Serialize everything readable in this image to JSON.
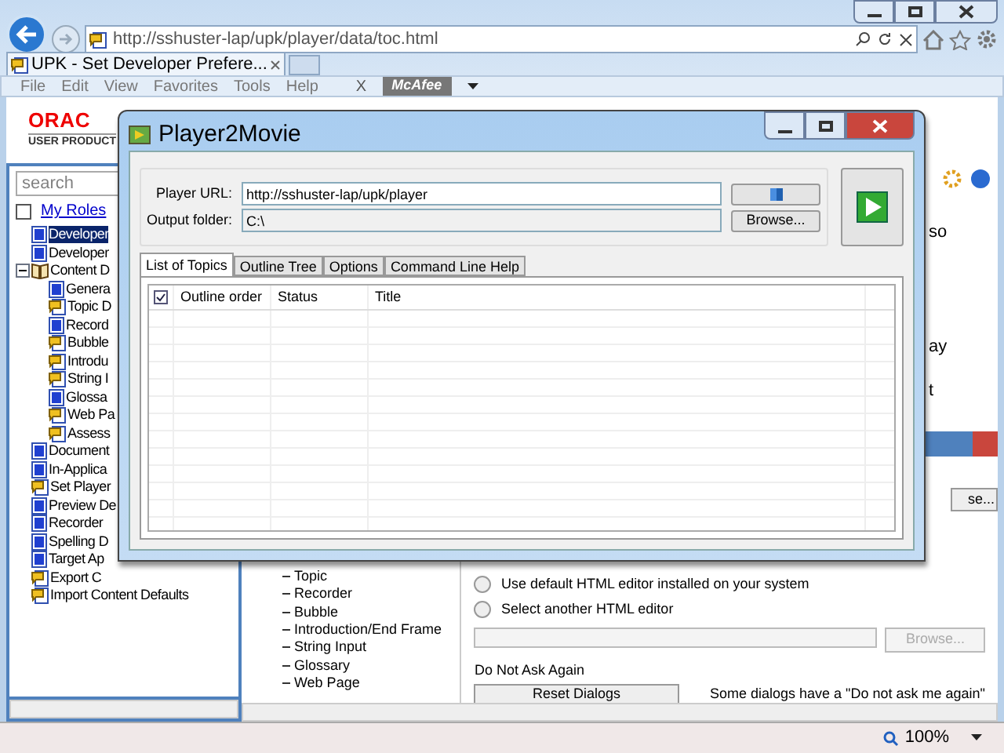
{
  "browser": {
    "address": "http://sshuster-lap/upk/player/data/toc.html",
    "tab": "UPK - Set Developer Prefere...",
    "menu": [
      "File",
      "Edit",
      "View",
      "Favorites",
      "Tools",
      "Help"
    ],
    "toolbar_close": "X",
    "addon": "McAfee",
    "zoom": "100%"
  },
  "logo": {
    "name": "ORAC",
    "subtitle": "USER PRODUCT"
  },
  "left_pane": {
    "search": {
      "placeholder": "search"
    },
    "roles": {
      "label": "My Roles",
      "checked": false
    },
    "tree": [
      {
        "label": "Developer",
        "kind": "page",
        "selected": true
      },
      {
        "label": "Developer",
        "kind": "page",
        "selected": false
      },
      {
        "label": "Content D",
        "kind": "book",
        "selected": false,
        "expanded": true,
        "children": [
          {
            "label": "Genera",
            "kind": "page",
            "selected": false
          },
          {
            "label": "Topic D",
            "kind": "bubble",
            "selected": false
          },
          {
            "label": "Record",
            "kind": "page",
            "selected": false
          },
          {
            "label": "Bubble",
            "kind": "bubble",
            "selected": false
          },
          {
            "label": "Introdu",
            "kind": "bubble",
            "selected": false
          },
          {
            "label": "String I",
            "kind": "bubble",
            "selected": false
          },
          {
            "label": "Glossa",
            "kind": "page",
            "selected": false
          },
          {
            "label": "Web Pa",
            "kind": "bubble",
            "selected": false
          },
          {
            "label": "Assess",
            "kind": "bubble",
            "selected": false
          }
        ]
      },
      {
        "label": "Document",
        "kind": "page",
        "selected": false
      },
      {
        "label": "In-Applica",
        "kind": "page",
        "selected": false
      },
      {
        "label": "Set Player",
        "kind": "bubble",
        "selected": false
      },
      {
        "label": "Preview De",
        "kind": "page",
        "selected": false
      },
      {
        "label": "Recorder",
        "kind": "page",
        "selected": false
      },
      {
        "label": "Spelling D",
        "kind": "page",
        "selected": false
      },
      {
        "label": "Target Ap",
        "kind": "page",
        "selected": false
      },
      {
        "label": "Export C",
        "kind": "bubble",
        "selected": false
      },
      {
        "label": "Import Content Defaults",
        "kind": "bubble",
        "selected": false
      }
    ]
  },
  "right_pane": {
    "fragments": [
      "so",
      "ay",
      "t"
    ],
    "browse_fragment": "se...",
    "outline": [
      "Topic",
      "Recorder",
      "Bubble",
      "Introduction/End Frame",
      "String Input",
      "Glossary",
      "Web Page"
    ],
    "editor_options": [
      {
        "label": "Use default HTML editor installed on your system",
        "selected": false
      },
      {
        "label": "Select another HTML editor",
        "selected": false
      }
    ],
    "browse": {
      "label": "Browse...",
      "disabled": true
    },
    "group": "Do Not Ask Again",
    "reset": "Reset Dialogs",
    "note": "Some dialogs have a \"Do not ask me again\""
  },
  "dialog": {
    "title": "Player2Movie",
    "player_url": {
      "label": "Player URL:",
      "value": "http://sshuster-lap/upk/player"
    },
    "output_folder": {
      "label": "Output folder:",
      "value": "C:\\"
    },
    "browse": "Browse...",
    "tabs": [
      {
        "label": "List of Topics",
        "selected": true
      },
      {
        "label": "Outline Tree",
        "selected": false
      },
      {
        "label": "Options",
        "selected": false
      },
      {
        "label": "Command Line Help",
        "selected": false
      }
    ],
    "table": {
      "select_all": true,
      "columns": [
        "Outline order",
        "Status",
        "Title"
      ]
    }
  }
}
